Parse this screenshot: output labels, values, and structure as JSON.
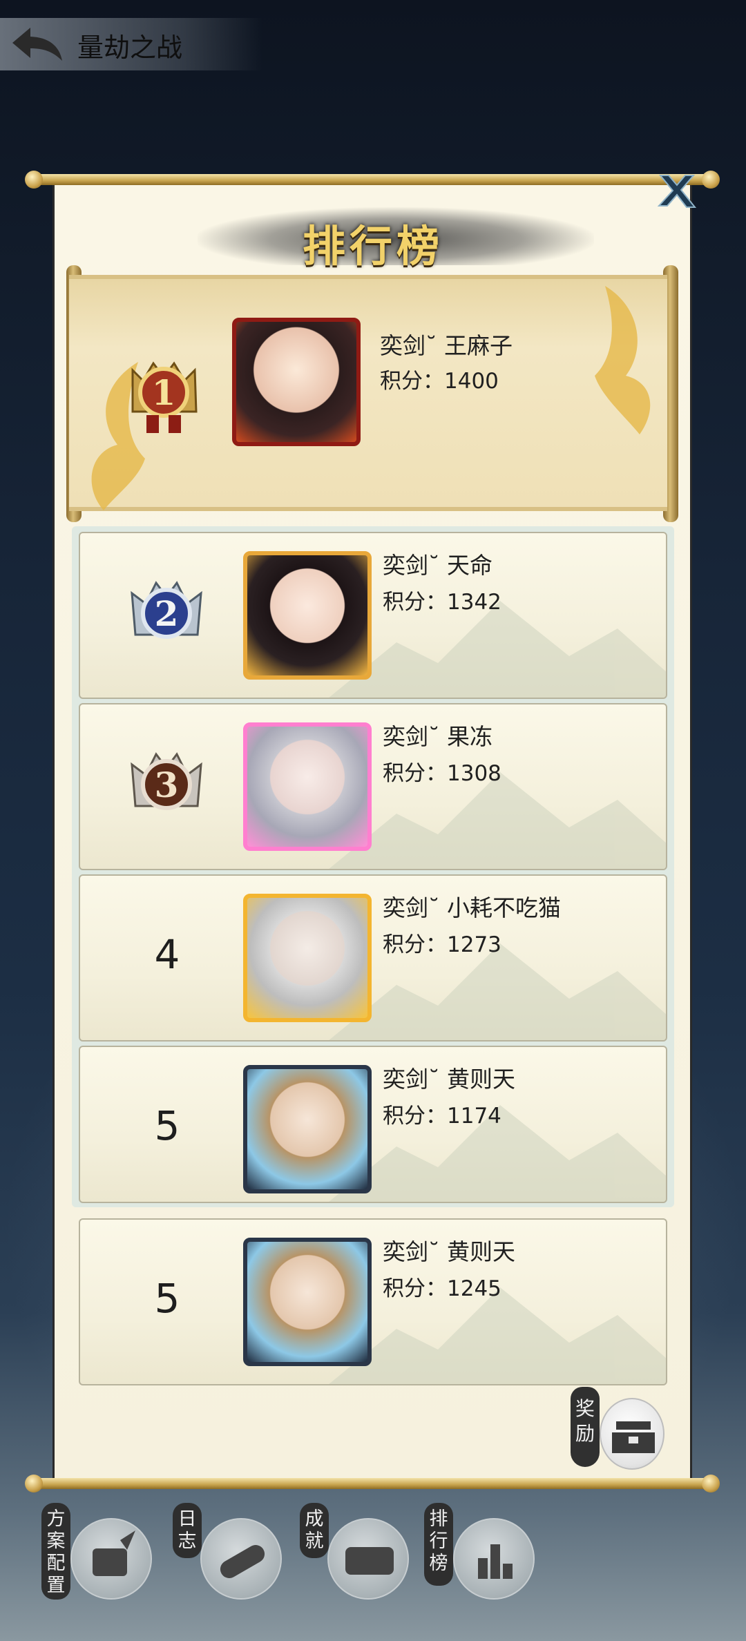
{
  "header": {
    "back_icon": "arrow-left-icon",
    "title": "量劫之战"
  },
  "panel": {
    "title": "排行榜",
    "close_icon": "close-x-icon"
  },
  "rankings": [
    {
      "rank": "1",
      "badge": "gold-rank-badge",
      "name": "奕剑˘ 王麻子",
      "score": "积分：1400"
    },
    {
      "rank": "2",
      "badge": "silver-rank-badge",
      "name": "奕剑˘ 天命",
      "score": "积分：1342"
    },
    {
      "rank": "3",
      "badge": "bronze-rank-badge",
      "name": "奕剑˘ 果冻",
      "score": "积分：1308"
    },
    {
      "rank": "4",
      "name": "奕剑˘ 小耗不吃猫",
      "score": "积分：1273"
    },
    {
      "rank": "5",
      "name": "奕剑˘ 黄则天",
      "score": "积分：1174"
    }
  ],
  "my_rank": {
    "rank": "5",
    "name": "奕剑˘ 黄则天",
    "score": "积分：1245"
  },
  "reward": {
    "label": "奖励",
    "icon": "treasure-chest-icon"
  },
  "bottom_nav": [
    {
      "label": "方案配置",
      "icon": "scroll-quill-icon"
    },
    {
      "label": "日志",
      "icon": "scroll-roll-icon"
    },
    {
      "label": "成就",
      "icon": "open-scroll-icon"
    },
    {
      "label": "排行榜",
      "icon": "bar-chart-icon"
    }
  ],
  "colors": {
    "gold": "#f2d26a",
    "paper": "#f6f1de",
    "frame": "#b7b39d"
  }
}
